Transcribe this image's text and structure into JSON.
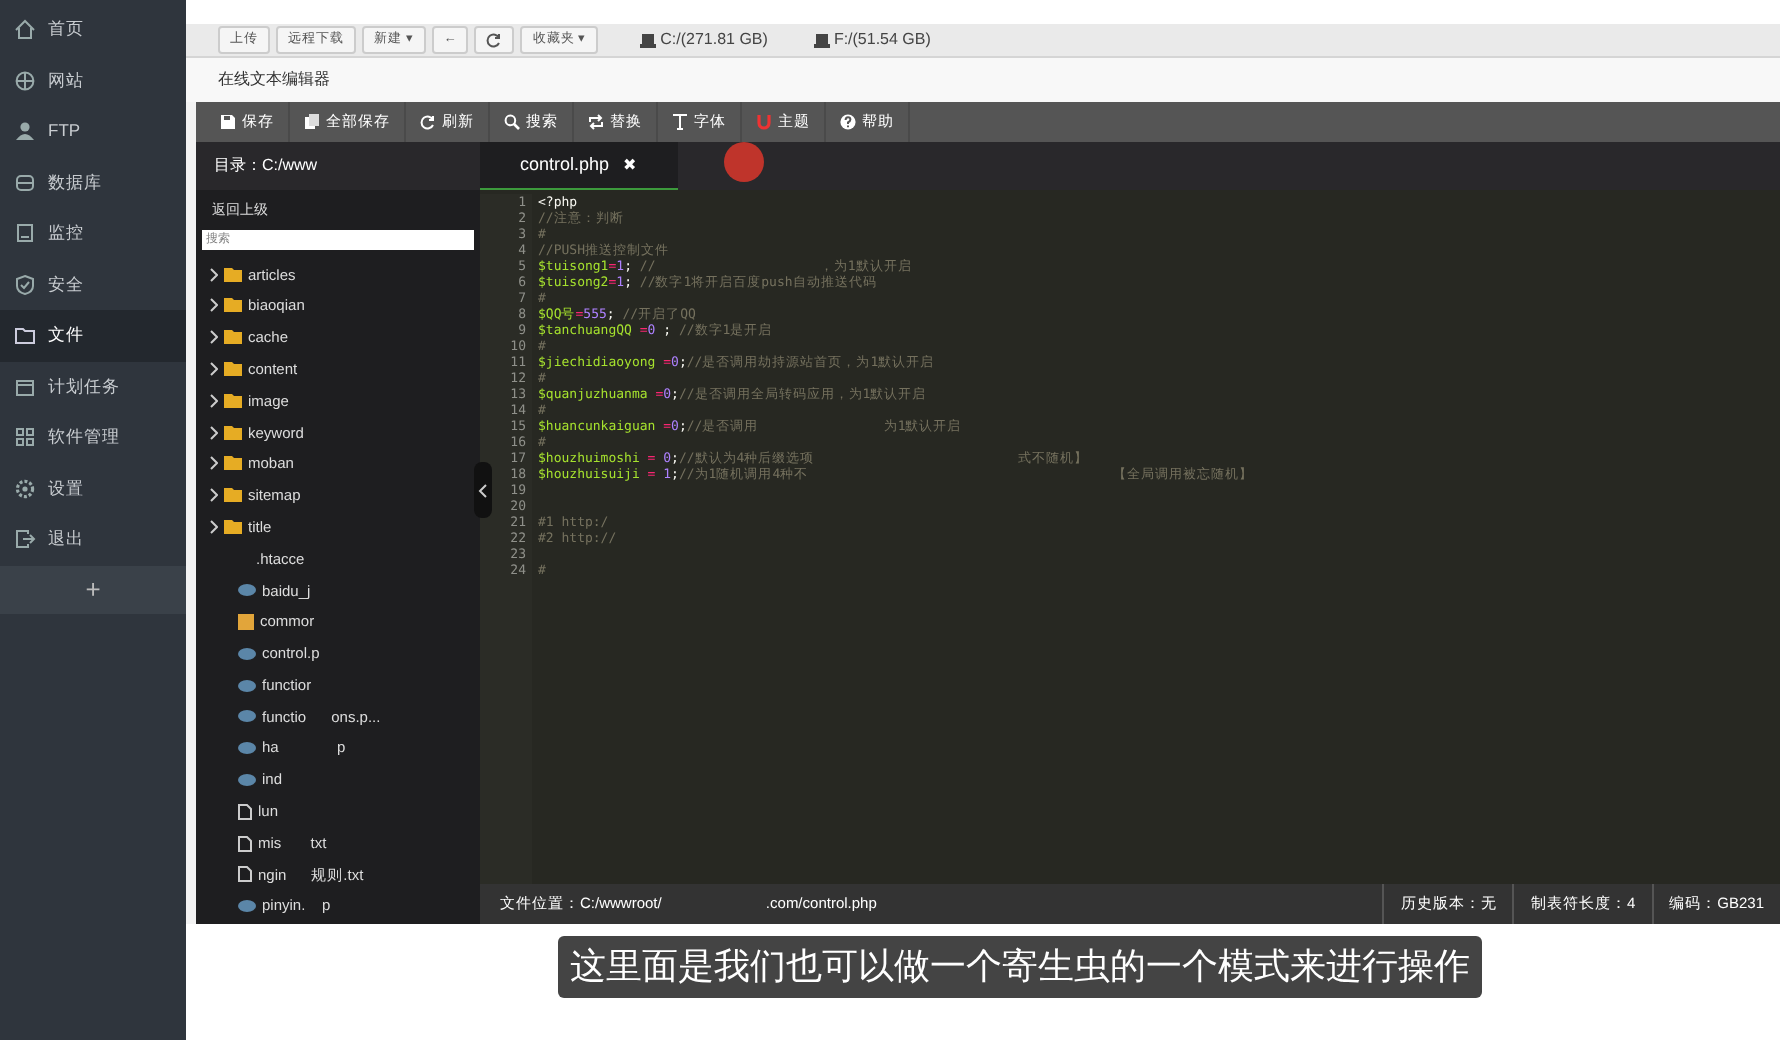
{
  "sidebar": {
    "items": [
      {
        "label": "首页",
        "selected": false
      },
      {
        "label": "网站",
        "selected": false
      },
      {
        "label": "FTP",
        "selected": false
      },
      {
        "label": "数据库",
        "selected": false
      },
      {
        "label": "监控",
        "selected": false
      },
      {
        "label": "安全",
        "selected": false
      },
      {
        "label": "文件",
        "selected": true
      },
      {
        "label": "计划任务",
        "selected": false
      },
      {
        "label": "软件管理",
        "selected": false
      },
      {
        "label": "设置",
        "selected": false
      },
      {
        "label": "退出",
        "selected": false
      }
    ],
    "add_label": "+"
  },
  "toolbar": {
    "buttons": [
      {
        "label": "上传",
        "kind": "text"
      },
      {
        "label": "远程下载",
        "kind": "text"
      },
      {
        "label": "新建 ▾",
        "kind": "text"
      },
      {
        "label": "←",
        "kind": "text"
      },
      {
        "kind": "refresh"
      },
      {
        "label": "收藏夹 ▾",
        "kind": "text"
      }
    ],
    "disks": [
      "C:/(271.81 GB)",
      "F:/(51.54 GB)"
    ]
  },
  "editor": {
    "title": "在线文本编辑器",
    "actions": [
      "保存",
      "全部保存",
      "刷新",
      "搜索",
      "替换",
      "字体",
      "主题",
      "帮助"
    ],
    "directory": "目录：C:/www",
    "tabs": [
      {
        "label": "control.php",
        "selected": true,
        "close": "✖"
      }
    ],
    "tree": {
      "back": "返回上级",
      "search_placeholder": "搜索",
      "items": [
        {
          "name": "articles",
          "kind": "folder"
        },
        {
          "name": "biaoqian",
          "kind": "folder"
        },
        {
          "name": "cache",
          "kind": "folder"
        },
        {
          "name": "content",
          "kind": "folder"
        },
        {
          "name": "image",
          "kind": "folder"
        },
        {
          "name": "keyword",
          "kind": "folder"
        },
        {
          "name": "moban",
          "kind": "folder"
        },
        {
          "name": "sitemap",
          "kind": "folder"
        },
        {
          "name": "title",
          "kind": "folder"
        },
        {
          "name": ".htacce",
          "kind": "plain"
        },
        {
          "name": "baidu_j",
          "kind": "php"
        },
        {
          "name": "commor",
          "kind": "js"
        },
        {
          "name": "control.p",
          "kind": "php"
        },
        {
          "name": "functior",
          "kind": "php"
        },
        {
          "name": "functio      ons.p...",
          "kind": "php"
        },
        {
          "name": "ha              p",
          "kind": "php"
        },
        {
          "name": "ind",
          "kind": "php"
        },
        {
          "name": "lun",
          "kind": "file"
        },
        {
          "name": "mis       txt",
          "kind": "file"
        },
        {
          "name": "ngin      规则.txt",
          "kind": "file"
        },
        {
          "name": "pinyin.    p",
          "kind": "php"
        }
      ]
    },
    "lines": [
      {
        "number": "1",
        "code": [
          {
            "kind": "plain",
            "text": "<?php"
          }
        ]
      },
      {
        "number": "2",
        "code": [
          {
            "kind": "comment",
            "text": "//注意：判断"
          }
        ]
      },
      {
        "number": "3",
        "code": [
          {
            "kind": "comment",
            "text": "#"
          }
        ]
      },
      {
        "number": "4",
        "code": [
          {
            "kind": "comment",
            "text": "//PUSH推送控制文件"
          }
        ]
      },
      {
        "number": "5",
        "code": [
          {
            "kind": "var",
            "text": "$tuisong1"
          },
          {
            "kind": "op",
            "text": "="
          },
          {
            "kind": "num",
            "text": "1"
          },
          {
            "kind": "plain",
            "text": "; "
          },
          {
            "kind": "comment",
            "text": "//                     ，为1默认开启"
          }
        ]
      },
      {
        "number": "6",
        "code": [
          {
            "kind": "var",
            "text": "$tuisong2"
          },
          {
            "kind": "op",
            "text": "="
          },
          {
            "kind": "num",
            "text": "1"
          },
          {
            "kind": "plain",
            "text": "; "
          },
          {
            "kind": "comment",
            "text": "//数字1将开启百度push自动推送代码"
          }
        ]
      },
      {
        "number": "7",
        "code": [
          {
            "kind": "comment",
            "text": "#"
          }
        ]
      },
      {
        "number": "8",
        "code": [
          {
            "kind": "var",
            "text": "$QQ号"
          },
          {
            "kind": "op",
            "text": "="
          },
          {
            "kind": "num",
            "text": "555"
          },
          {
            "kind": "plain",
            "text": "; "
          },
          {
            "kind": "comment",
            "text": "//开启了QQ"
          }
        ]
      },
      {
        "number": "9",
        "code": [
          {
            "kind": "var",
            "text": "$tanchuangQQ "
          },
          {
            "kind": "op",
            "text": "="
          },
          {
            "kind": "num",
            "text": "0"
          },
          {
            "kind": "plain",
            "text": " ; "
          },
          {
            "kind": "comment",
            "text": "//数字1是开启"
          }
        ]
      },
      {
        "number": "10",
        "code": [
          {
            "kind": "comment",
            "text": "#"
          }
        ]
      },
      {
        "number": "11",
        "code": [
          {
            "kind": "var",
            "text": "$jiechidiaoyong "
          },
          {
            "kind": "op",
            "text": "="
          },
          {
            "kind": "num",
            "text": "0"
          },
          {
            "kind": "plain",
            "text": ";"
          },
          {
            "kind": "comment",
            "text": "//是否调用劫持源站首页，为1默认开启"
          }
        ]
      },
      {
        "number": "12",
        "code": [
          {
            "kind": "comment",
            "text": "#"
          }
        ]
      },
      {
        "number": "13",
        "code": [
          {
            "kind": "var",
            "text": "$quanjuzhuanma "
          },
          {
            "kind": "op",
            "text": "="
          },
          {
            "kind": "num",
            "text": "0"
          },
          {
            "kind": "plain",
            "text": ";"
          },
          {
            "kind": "comment",
            "text": "//是否调用全局转码应用，为1默认开启"
          }
        ]
      },
      {
        "number": "14",
        "code": [
          {
            "kind": "comment",
            "text": "#"
          }
        ]
      },
      {
        "number": "15",
        "code": [
          {
            "kind": "var",
            "text": "$huancunkaiguan "
          },
          {
            "kind": "op",
            "text": "="
          },
          {
            "kind": "num",
            "text": "0"
          },
          {
            "kind": "plain",
            "text": ";"
          },
          {
            "kind": "comment",
            "text": "//是否调用                为1默认开启"
          }
        ]
      },
      {
        "number": "16",
        "code": [
          {
            "kind": "comment",
            "text": "#"
          }
        ]
      },
      {
        "number": "17",
        "code": [
          {
            "kind": "var",
            "text": "$houzhuimoshi "
          },
          {
            "kind": "op",
            "text": "="
          },
          {
            "kind": "num",
            "text": " 0"
          },
          {
            "kind": "plain",
            "text": ";"
          },
          {
            "kind": "comment",
            "text": "//默认为4种后缀选项                          式不随机】"
          }
        ]
      },
      {
        "number": "18",
        "code": [
          {
            "kind": "var",
            "text": "$houzhuisuiji "
          },
          {
            "kind": "op",
            "text": "="
          },
          {
            "kind": "num",
            "text": " 1"
          },
          {
            "kind": "plain",
            "text": ";"
          },
          {
            "kind": "comment",
            "text": "//为1随机调用4种不                                       【全局调用被忘随机】"
          }
        ]
      },
      {
        "number": "19"
      },
      {
        "number": "20"
      },
      {
        "number": "21",
        "code": [
          {
            "kind": "comment",
            "text": "#1 http:/"
          }
        ]
      },
      {
        "number": "22",
        "code": [
          {
            "kind": "comment",
            "text": "#2 http://"
          }
        ]
      },
      {
        "number": "23"
      },
      {
        "number": "24",
        "code": [
          {
            "kind": "comment",
            "text": "#"
          }
        ]
      }
    ],
    "status": {
      "path": "文件位置：C:/wwwroot/                         .com/control.php",
      "items": [
        "历史版本：无",
        "制表符长度：4",
        "编码：GB231"
      ]
    }
  },
  "subtitle": "这里面是我们也可以做一个寄生虫的一个模式来进行操作"
}
